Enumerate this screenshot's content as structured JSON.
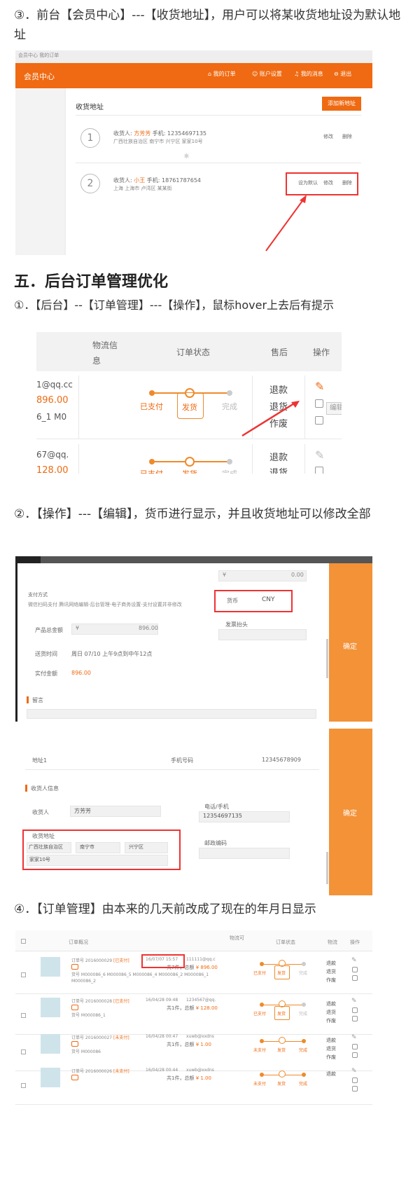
{
  "p1": "③．前台【会员中心】---【收货地址】，用户可以将某收货地址设为默认地址",
  "s1": {
    "top_hint": "会员中心 我的订单",
    "brand": "会员中心",
    "nav": [
      "我的订单",
      "账户设置",
      "我的消息",
      "退出"
    ],
    "section": "收货地址",
    "add_btn": "添加新地址",
    "addr": [
      {
        "no": "1",
        "lbl": "收货人: ",
        "name": "方芳芳",
        "phone": "手机: 12354697135",
        "addr": "广西壮族自治区 南宁市 兴宁区 家家10号",
        "ops": [
          "修改",
          "删除"
        ]
      },
      {
        "no": "2",
        "lbl": "收货人: ",
        "name": "小王",
        "phone": "手机: 18761787654",
        "addr": "上海 上海市 卢湾区 某某街",
        "ops": [
          "设为默认",
          "修改",
          "删除"
        ]
      }
    ]
  },
  "h5": "五．后台订单管理优化",
  "p2": "①．【后台】--【订单管理】---【操作】，鼠标hover上去后有提示",
  "s2": {
    "headers": [
      "物流信息",
      "订单状态",
      "售后",
      "操作"
    ],
    "r1": {
      "email": "1@qq.cc",
      "amount": "896.00",
      "code": "6_1 M0",
      "steps": [
        "已支付",
        "发货",
        "完成"
      ],
      "after": [
        "退款",
        "退货",
        "作废"
      ],
      "tip": "编辑"
    },
    "r2": {
      "email": "67@qq.",
      "amount": "128.00",
      "steps": [
        "已支付",
        "发货",
        "完成"
      ],
      "after": [
        "退款",
        "退货"
      ]
    }
  },
  "p3": "②．【操作】---【编辑】，货币进行显示，并且收货地址可以修改全部",
  "s3": {
    "yen": "¥",
    "val0": "0.00",
    "pay_method_lbl": "支付方式",
    "pay_method": "微信扫码支付 腾讯网络编辑-后台管理-电子商务设置-支付设置并非修改",
    "cur_lbl": "货币",
    "cur": "CNY",
    "total_lbl": "产品总金额",
    "total": "896.00",
    "inv_lbl": "发票抬头",
    "deliv_lbl": "送货时间",
    "deliv": "周日 07/10 上午9点到中午12点",
    "paid_lbl": "实付金额",
    "paid": "896.00",
    "note": "留言",
    "ok": "确定"
  },
  "s4": {
    "row": [
      "地址1",
      "手机号码",
      "12345678909"
    ],
    "sec": "收货人信息",
    "rc_lbl": "收货人",
    "rc": "方芳芳",
    "ph_lbl": "电话/手机",
    "ph": "12354697135",
    "ad_lbl": "收货地址",
    "prov": "广西壮族自治区",
    "city": "南宁市",
    "dist": "兴宁区",
    "street": "家家10号",
    "zip_lbl": "邮政编码",
    "ok": "确定"
  },
  "p4": "④．【订单管理】由本来的几天前改成了现在的年月日显示",
  "s5": {
    "headers": [
      "订单概况",
      "物流可",
      "订单状态",
      "物流",
      "操作"
    ],
    "rows": [
      {
        "ord": "订单号 2016000029",
        "st": "[已支付]",
        "date": "16/07/07 15:57",
        "mail": "111111@qq.c",
        "sum": "共7件，总额",
        "amt": "¥ 896.00",
        "goods": "货号 M000086_6 M000086_5 M000086_4 M000086_2 M000086_1 M000086_2",
        "steps": [
          "已支付",
          "发货",
          "完成"
        ],
        "after": [
          "退款",
          "退货",
          "作废"
        ]
      },
      {
        "ord": "订单号 2016000028",
        "st": "[已支付]",
        "date": "16/04/28 09:48",
        "mail": "1234567@qq.",
        "sum": "共1件，总额",
        "amt": "¥ 128.00",
        "goods": "货号 M000086_1",
        "steps": [
          "已支付",
          "发货",
          "完成"
        ],
        "after": [
          "退款",
          "退货",
          "作废"
        ]
      },
      {
        "ord": "订单号 2016000027",
        "st": "[未支付]",
        "date": "16/04/28 00:47",
        "mail": "xuwb@xxdns",
        "sum": "共1件，总额",
        "amt": "¥ 1.00",
        "goods": "货号 M000086",
        "steps": [
          "未支付",
          "发货",
          "完成"
        ],
        "after": [
          "退款",
          "退货",
          "作废"
        ]
      },
      {
        "ord": "订单号 2016000026",
        "st": "[未支付]",
        "date": "16/04/28 00:44",
        "mail": "xuwb@xxdns",
        "sum": "共1件，总额",
        "amt": "¥ 1.00",
        "goods": "",
        "steps": [
          "未支付",
          "发货",
          "完成"
        ],
        "after": [
          "退款"
        ]
      }
    ]
  }
}
